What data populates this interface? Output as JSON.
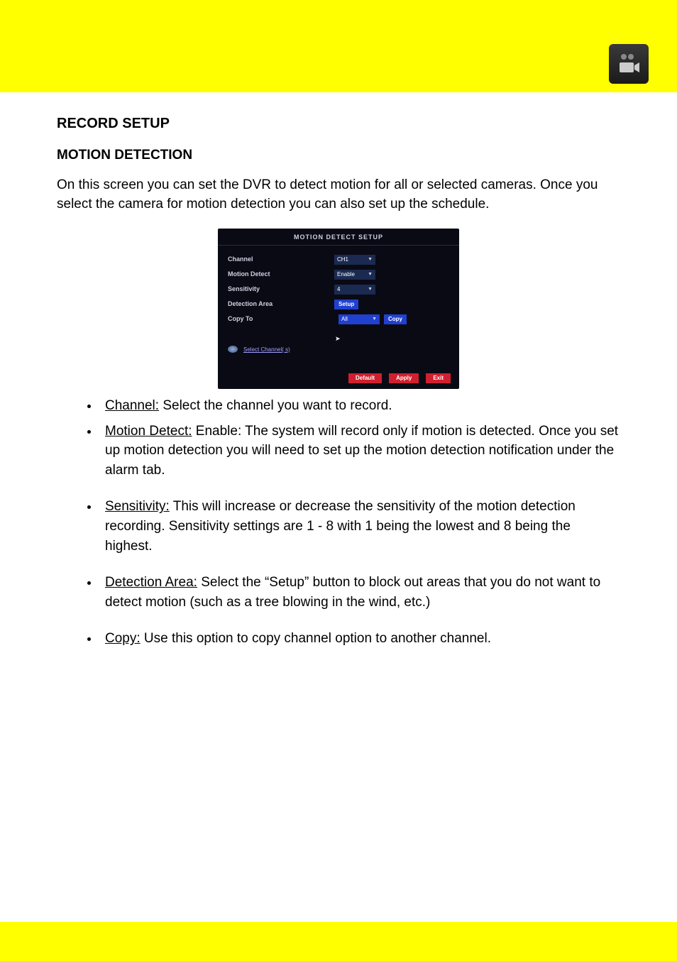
{
  "header": {
    "icon": "camera-record-icon"
  },
  "section": {
    "heading": "RECORD SETUP",
    "subheading": "MOTION DETECTION",
    "intro": "On this screen you can set the DVR to detect motion for all or selected cameras. Once you select the camera for motion detection you can also set up the schedule."
  },
  "dvr": {
    "title": "MOTION  DETECT  SETUP",
    "rows": {
      "channel": {
        "label": "Channel",
        "value": "CH1"
      },
      "motion": {
        "label": "Motion Detect",
        "value": "Enable"
      },
      "sensitivity": {
        "label": "Sensitivity",
        "value": "4"
      },
      "area": {
        "label": "Detection Area",
        "button": "Setup"
      },
      "copy": {
        "label": "Copy To",
        "value": "All",
        "button": "Copy"
      }
    },
    "nav": "Select  Channel( s)",
    "footer": {
      "default": "Default",
      "apply": "Apply",
      "exit": "Exit"
    }
  },
  "bullets": {
    "b1_term": "Channel:",
    "b1_text": " Select the channel you want to record.",
    "b2_term": "Motion Detect:",
    "b2_text": " Enable: The system will record only if motion is detected. Once you set up motion detection you will need to set up the motion detection notification under the alarm tab.",
    "b3_term": "Sensitivity:",
    "b3_text": " This will increase or decrease the sensitivity of the motion detection recording. Sensitivity settings are 1 - 8 with 1 being the lowest and 8 being the highest.",
    "b4_term": "Detection Area:",
    "b4_text": " Select the “Setup” button to block out areas that you do not want to detect motion (such as a tree blowing in the wind, etc.)",
    "b5_term": "Copy:",
    "b5_text": " Use this option to copy channel option to another channel."
  }
}
